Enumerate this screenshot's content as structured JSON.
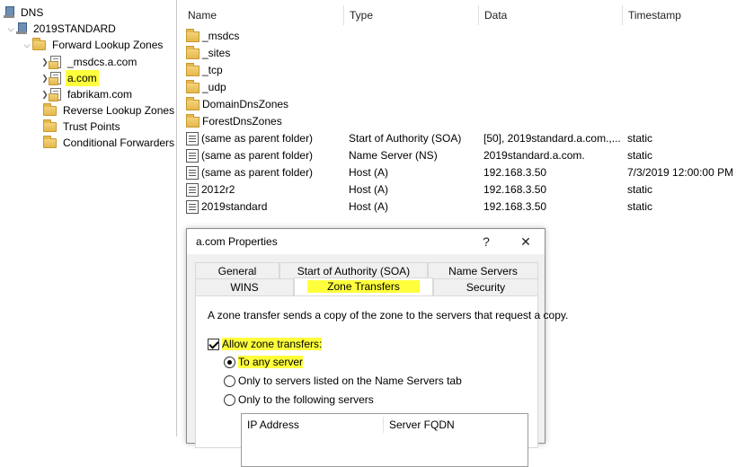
{
  "tree": {
    "root": "DNS",
    "server": "2019STANDARD",
    "forward": "Forward Lookup Zones",
    "zones": [
      "_msdcs.a.com",
      "a.com",
      "fabrikam.com"
    ],
    "reverse": "Reverse Lookup Zones",
    "trust": "Trust Points",
    "conditional": "Conditional Forwarders",
    "highlight_color": "#ffff3c"
  },
  "list": {
    "columns": [
      "Name",
      "Type",
      "Data",
      "Timestamp"
    ],
    "rows": [
      {
        "icon": "folder-icon",
        "name": "_msdcs",
        "type": "",
        "data": "",
        "timestamp": ""
      },
      {
        "icon": "folder-icon",
        "name": "_sites",
        "type": "",
        "data": "",
        "timestamp": ""
      },
      {
        "icon": "folder-icon",
        "name": "_tcp",
        "type": "",
        "data": "",
        "timestamp": ""
      },
      {
        "icon": "folder-icon",
        "name": "_udp",
        "type": "",
        "data": "",
        "timestamp": ""
      },
      {
        "icon": "folder-icon",
        "name": "DomainDnsZones",
        "type": "",
        "data": "",
        "timestamp": ""
      },
      {
        "icon": "folder-icon",
        "name": "ForestDnsZones",
        "type": "",
        "data": "",
        "timestamp": ""
      },
      {
        "icon": "record-icon",
        "name": "(same as parent folder)",
        "type": "Start of Authority (SOA)",
        "data": "[50], 2019standard.a.com.,...",
        "timestamp": "static"
      },
      {
        "icon": "record-icon",
        "name": "(same as parent folder)",
        "type": "Name Server (NS)",
        "data": "2019standard.a.com.",
        "timestamp": "static"
      },
      {
        "icon": "record-icon",
        "name": "(same as parent folder)",
        "type": "Host (A)",
        "data": "192.168.3.50",
        "timestamp": "7/3/2019 12:00:00 PM"
      },
      {
        "icon": "record-icon",
        "name": "2012r2",
        "type": "Host (A)",
        "data": "192.168.3.50",
        "timestamp": "static"
      },
      {
        "icon": "record-icon",
        "name": "2019standard",
        "type": "Host (A)",
        "data": "192.168.3.50",
        "timestamp": "static"
      }
    ]
  },
  "dialog": {
    "title": "a.com Properties",
    "help": "?",
    "close": "✕",
    "tabs_back": [
      "General",
      "Start of Authority (SOA)",
      "Name Servers"
    ],
    "tabs_front": [
      "WINS",
      "Zone Transfers",
      "Security"
    ],
    "active_tab": "Zone Transfers",
    "description": "A zone transfer sends a copy of the zone to the servers that request a copy.",
    "allow_label": "Allow zone transfers:",
    "allow_checked": true,
    "radios": [
      {
        "label": "To any server",
        "selected": true
      },
      {
        "label": "Only to servers listed on the Name Servers tab",
        "selected": false
      },
      {
        "label": "Only to the following servers",
        "selected": false
      }
    ],
    "grid_columns": [
      "IP Address",
      "Server FQDN"
    ]
  }
}
